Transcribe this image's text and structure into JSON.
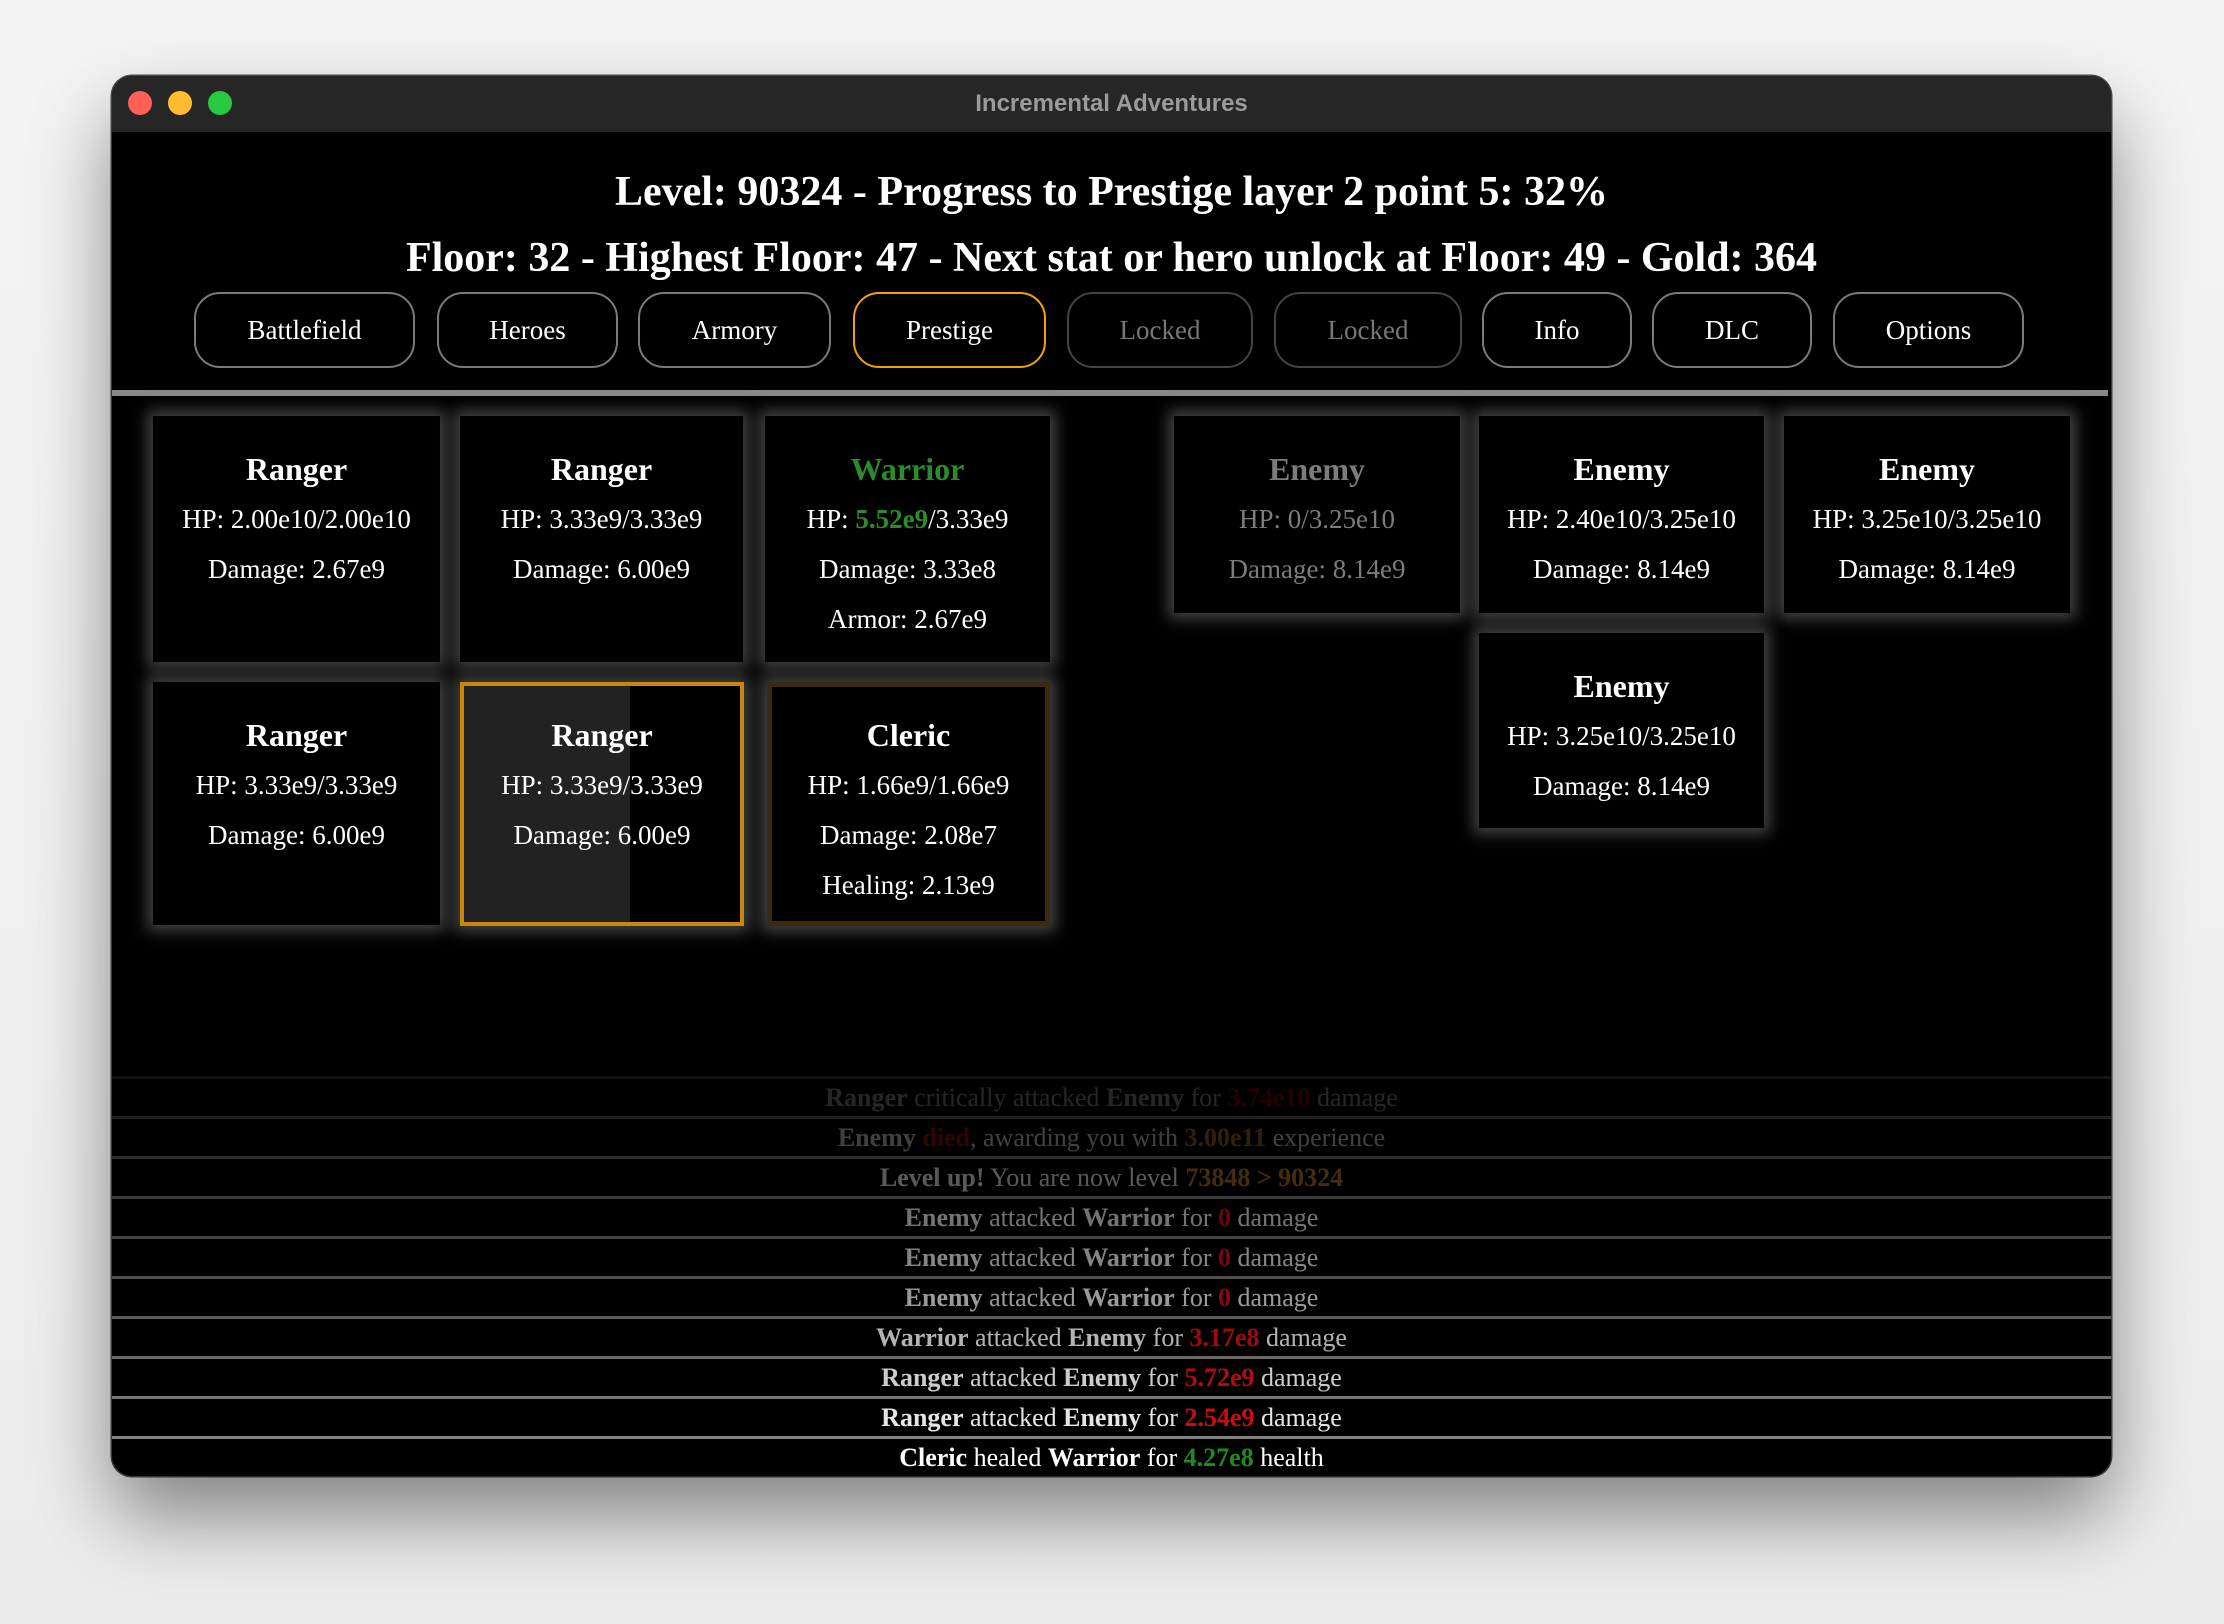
{
  "window": {
    "title": "Incremental Adventures"
  },
  "header": {
    "line1": "Level: 90324 - Progress to Prestige layer 2 point 5: 32%",
    "line2": "Floor: 32 - Highest Floor: 47 - Next stat or hero unlock at Floor: 49 - Gold: 364",
    "level": 90324,
    "prestige_progress_percent": 32,
    "floor": 32,
    "highest_floor": 47,
    "next_unlock_floor": 49,
    "gold": 364
  },
  "tabs": [
    {
      "label": "Battlefield",
      "state": "normal"
    },
    {
      "label": "Heroes",
      "state": "normal"
    },
    {
      "label": "Armory",
      "state": "normal"
    },
    {
      "label": "Prestige",
      "state": "active"
    },
    {
      "label": "Locked",
      "state": "locked"
    },
    {
      "label": "Locked",
      "state": "locked"
    },
    {
      "label": "Info",
      "state": "normal"
    },
    {
      "label": "DLC",
      "state": "normal"
    },
    {
      "label": "Options",
      "state": "normal"
    }
  ],
  "heroes": [
    {
      "name": "Ranger",
      "hp_label": "HP: ",
      "hp_current": "2.00e10",
      "hp_max": "2.00e10",
      "stats": [
        "Damage: 2.67e9"
      ]
    },
    {
      "name": "Ranger",
      "hp_label": "HP: ",
      "hp_current": "3.33e9",
      "hp_max": "3.33e9",
      "stats": [
        "Damage: 6.00e9"
      ]
    },
    {
      "name": "Warrior",
      "hp_label": "HP: ",
      "hp_current": "5.52e9",
      "hp_max": "3.33e9",
      "stats": [
        "Damage: 3.33e8",
        "Armor: 2.67e9"
      ],
      "name_color": "#2a8c2a",
      "hp_current_color": "#2a8c2a"
    },
    {
      "name": "Ranger",
      "hp_label": "HP: ",
      "hp_current": "3.33e9",
      "hp_max": "3.33e9",
      "stats": [
        "Damage: 6.00e9"
      ]
    },
    {
      "name": "Ranger",
      "hp_label": "HP: ",
      "hp_current": "3.33e9",
      "hp_max": "3.33e9",
      "stats": [
        "Damage: 6.00e9"
      ],
      "selected": true,
      "charge_fraction": 0.6
    },
    {
      "name": "Cleric",
      "hp_label": "HP: ",
      "hp_current": "1.66e9",
      "hp_max": "1.66e9",
      "stats": [
        "Damage: 2.08e7",
        "Healing: 2.13e9"
      ]
    }
  ],
  "enemies": [
    {
      "name": "Enemy",
      "hp": "HP: 0/3.25e10",
      "damage": "Damage: 8.14e9",
      "dead": true
    },
    {
      "name": "Enemy",
      "hp": "HP: 2.40e10/3.25e10",
      "damage": "Damage: 8.14e9"
    },
    {
      "name": "Enemy",
      "hp": "HP: 3.25e10/3.25e10",
      "damage": "Damage: 8.14e9"
    },
    {
      "name": "Enemy",
      "hp": "HP: 3.25e10/3.25e10",
      "damage": "Damage: 8.14e9"
    }
  ],
  "log": [
    {
      "parts": [
        [
          "b",
          "Ranger"
        ],
        [
          "t",
          " critically attacked "
        ],
        [
          "b",
          "Enemy"
        ],
        [
          "t",
          " for "
        ],
        [
          "red",
          "3.74e10"
        ],
        [
          "t",
          " damage"
        ]
      ],
      "opacity": 0.15
    },
    {
      "parts": [
        [
          "b",
          "Enemy"
        ],
        [
          "t",
          " "
        ],
        [
          "wred",
          "died"
        ],
        [
          "t",
          ", awarding you with "
        ],
        [
          "gold",
          "3.00e11"
        ],
        [
          "t",
          " experience"
        ]
      ],
      "opacity": 0.25
    },
    {
      "parts": [
        [
          "b",
          "Level up!"
        ],
        [
          "t",
          " You are now level "
        ],
        [
          "gold",
          "73848 > 90324"
        ]
      ],
      "opacity": 0.35
    },
    {
      "parts": [
        [
          "b",
          "Enemy"
        ],
        [
          "t",
          " attacked "
        ],
        [
          "b",
          "Warrior"
        ],
        [
          "t",
          " for "
        ],
        [
          "red",
          "0"
        ],
        [
          "t",
          " damage"
        ]
      ],
      "opacity": 0.45
    },
    {
      "parts": [
        [
          "b",
          "Enemy"
        ],
        [
          "t",
          " attacked "
        ],
        [
          "b",
          "Warrior"
        ],
        [
          "t",
          " for "
        ],
        [
          "red",
          "0"
        ],
        [
          "t",
          " damage"
        ]
      ],
      "opacity": 0.52
    },
    {
      "parts": [
        [
          "b",
          "Enemy"
        ],
        [
          "t",
          " attacked "
        ],
        [
          "b",
          "Warrior"
        ],
        [
          "t",
          " for "
        ],
        [
          "red",
          "0"
        ],
        [
          "t",
          " damage"
        ]
      ],
      "opacity": 0.6
    },
    {
      "parts": [
        [
          "b",
          "Warrior"
        ],
        [
          "t",
          " attacked "
        ],
        [
          "b",
          "Enemy"
        ],
        [
          "t",
          " for "
        ],
        [
          "red",
          "3.17e8"
        ],
        [
          "t",
          " damage"
        ]
      ],
      "opacity": 0.7
    },
    {
      "parts": [
        [
          "b",
          "Ranger"
        ],
        [
          "t",
          " attacked "
        ],
        [
          "b",
          "Enemy"
        ],
        [
          "t",
          " for "
        ],
        [
          "red",
          "5.72e9"
        ],
        [
          "t",
          " damage"
        ]
      ],
      "opacity": 0.8
    },
    {
      "parts": [
        [
          "b",
          "Ranger"
        ],
        [
          "t",
          " attacked "
        ],
        [
          "b",
          "Enemy"
        ],
        [
          "t",
          " for "
        ],
        [
          "red",
          "2.54e9"
        ],
        [
          "t",
          " damage"
        ]
      ],
      "opacity": 0.9
    },
    {
      "parts": [
        [
          "b",
          "Cleric"
        ],
        [
          "t",
          " healed "
        ],
        [
          "b",
          "Warrior"
        ],
        [
          "t",
          " for "
        ],
        [
          "green",
          "4.27e8"
        ],
        [
          "t",
          " health"
        ]
      ],
      "opacity": 1.0
    }
  ],
  "colors": {
    "accent_active_tab": "#f5a100",
    "selected_card_border": "#cc860c",
    "cleric_card_border": "#3b2a10",
    "heal_green": "#1e8c1e",
    "damage_red": "#e01010",
    "gold": "#c08020"
  }
}
